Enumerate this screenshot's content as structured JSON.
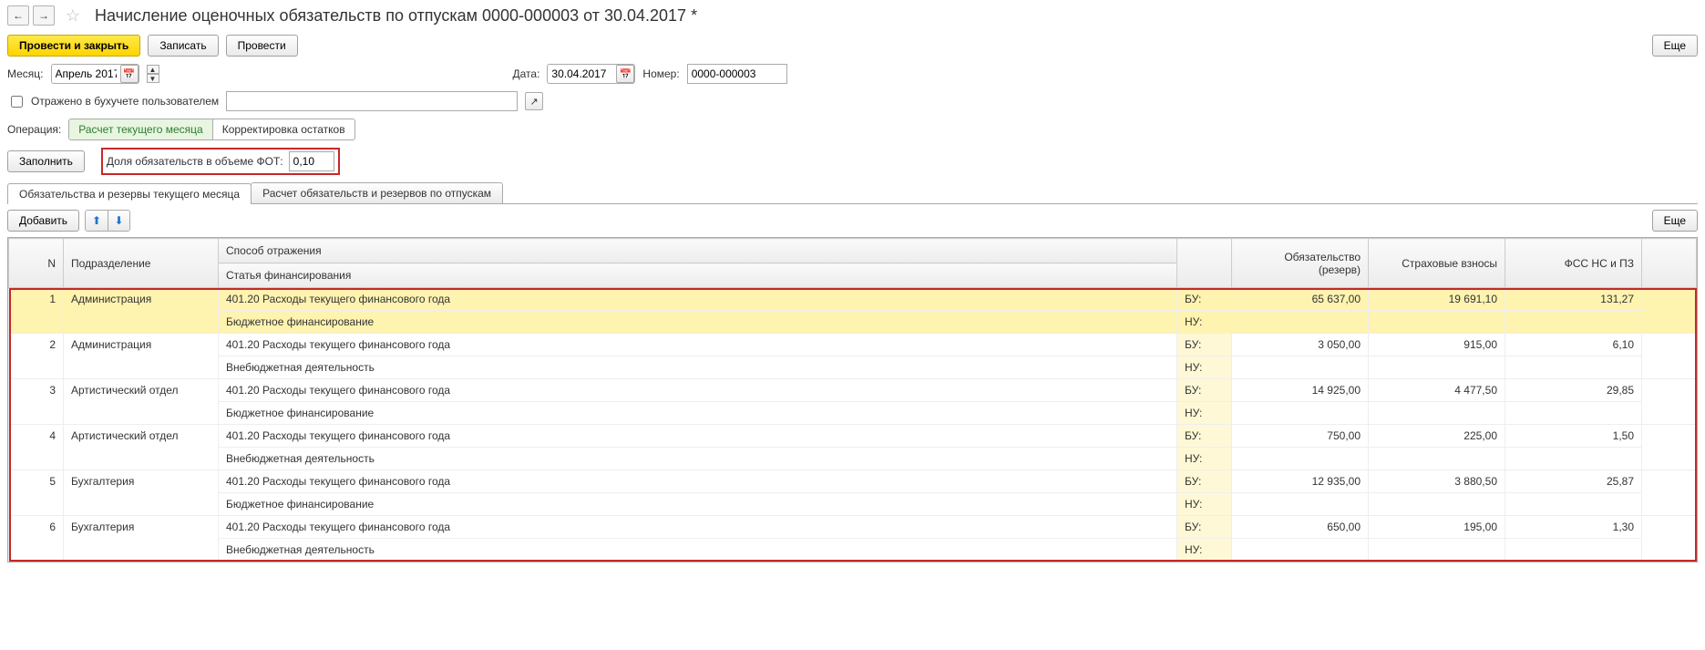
{
  "header": {
    "title": "Начисление оценочных обязательств по отпускам 0000-000003 от 30.04.2017 *"
  },
  "toolbar": {
    "post_close": "Провести и закрыть",
    "save": "Записать",
    "post": "Провести",
    "more": "Еще"
  },
  "fields": {
    "month_label": "Месяц:",
    "month_value": "Апрель 2017",
    "date_label": "Дата:",
    "date_value": "30.04.2017",
    "number_label": "Номер:",
    "number_value": "0000-000003",
    "reflected_label": "Отражено в бухучете пользователем",
    "operation_label": "Операция:",
    "op_current": "Расчет текущего месяца",
    "op_correction": "Корректировка остатков",
    "fill": "Заполнить",
    "share_label": "Доля обязательств в объеме ФОТ:",
    "share_value": "0,10"
  },
  "tabs": {
    "tab1": "Обязательства и резервы текущего месяца",
    "tab2": "Расчет обязательств и резервов по отпускам"
  },
  "subtoolbar": {
    "add": "Добавить",
    "more": "Еще"
  },
  "table": {
    "headers": {
      "n": "N",
      "dept": "Подразделение",
      "method": "Способ отражения",
      "finance": "Статья финансирования",
      "oblig": "Обязательство (резерв)",
      "insurance": "Страховые взносы",
      "fss": "ФСС НС и ПЗ"
    },
    "rows": [
      {
        "n": "1",
        "dept": "Администрация",
        "method": "401.20 Расходы текущего финансового года",
        "finance": "Бюджетное финансирование",
        "bu": "БУ:",
        "nu": "НУ:",
        "oblig": "65 637,00",
        "ins": "19 691,10",
        "fss": "131,27",
        "highlight": true
      },
      {
        "n": "2",
        "dept": "Администрация",
        "method": "401.20 Расходы текущего финансового года",
        "finance": "Внебюджетная деятельность",
        "bu": "БУ:",
        "nu": "НУ:",
        "oblig": "3 050,00",
        "ins": "915,00",
        "fss": "6,10"
      },
      {
        "n": "3",
        "dept": "Артистический отдел",
        "method": "401.20 Расходы текущего финансового года",
        "finance": "Бюджетное финансирование",
        "bu": "БУ:",
        "nu": "НУ:",
        "oblig": "14 925,00",
        "ins": "4 477,50",
        "fss": "29,85"
      },
      {
        "n": "4",
        "dept": "Артистический отдел",
        "method": "401.20 Расходы текущего финансового года",
        "finance": "Внебюджетная деятельность",
        "bu": "БУ:",
        "nu": "НУ:",
        "oblig": "750,00",
        "ins": "225,00",
        "fss": "1,50"
      },
      {
        "n": "5",
        "dept": "Бухгалтерия",
        "method": "401.20 Расходы текущего финансового года",
        "finance": "Бюджетное финансирование",
        "bu": "БУ:",
        "nu": "НУ:",
        "oblig": "12 935,00",
        "ins": "3 880,50",
        "fss": "25,87"
      },
      {
        "n": "6",
        "dept": "Бухгалтерия",
        "method": "401.20 Расходы текущего финансового года",
        "finance": "Внебюджетная деятельность",
        "bu": "БУ:",
        "nu": "НУ:",
        "oblig": "650,00",
        "ins": "195,00",
        "fss": "1,30"
      }
    ]
  }
}
